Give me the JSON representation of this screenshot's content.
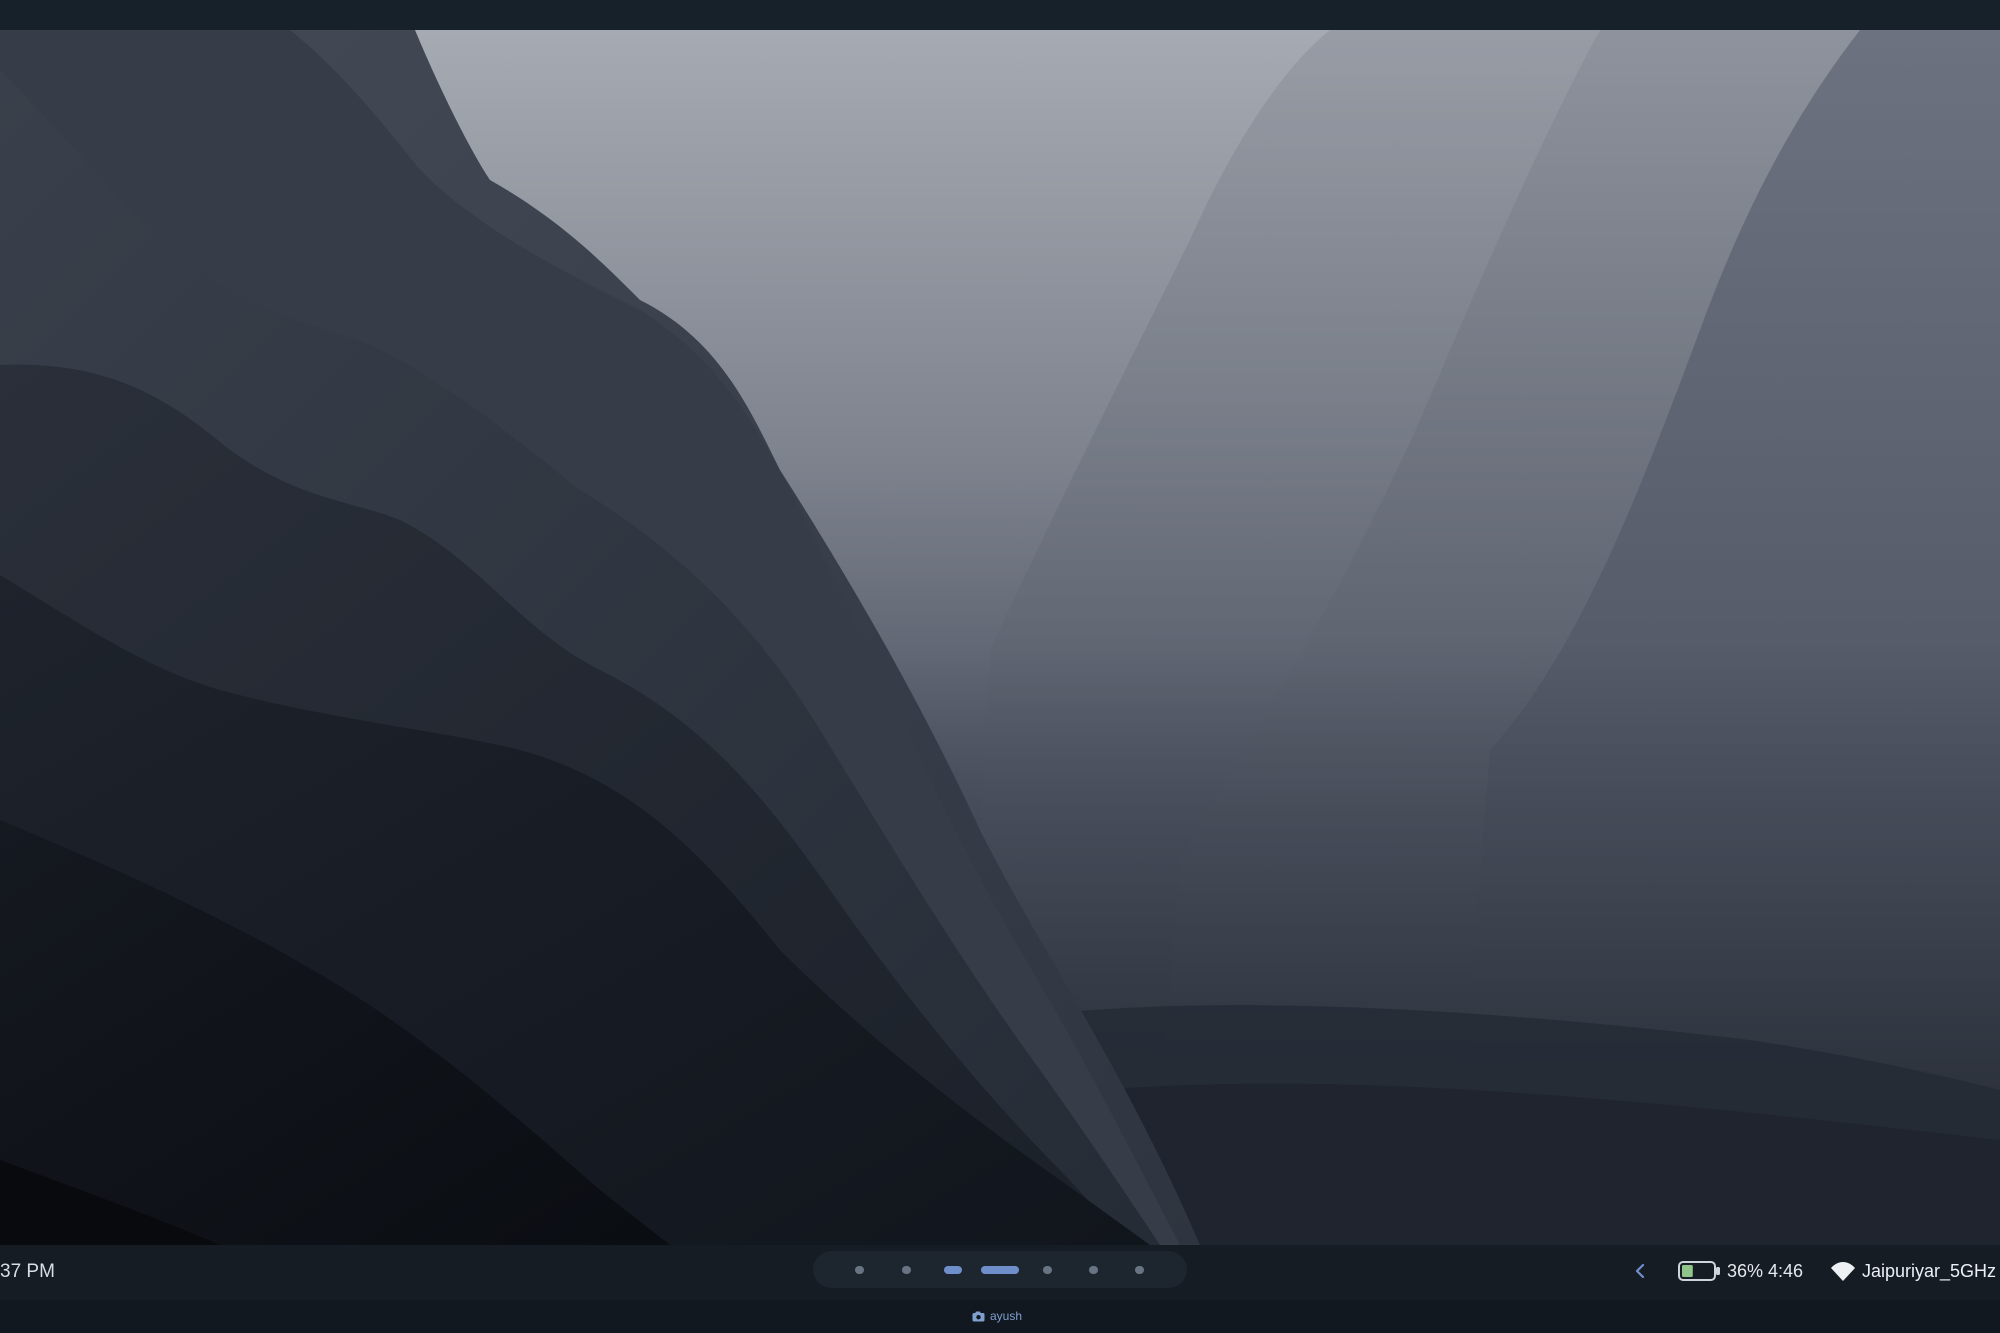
{
  "taskbar": {
    "clock_text": "37 PM",
    "workspaces": [
      {
        "label": "workspace 1",
        "active": false
      },
      {
        "label": "workspace 2",
        "active": false
      },
      {
        "label": "workspace 3",
        "active": true
      },
      {
        "label": "workspace 4",
        "active": true
      },
      {
        "label": "workspace 5",
        "active": false
      },
      {
        "label": "workspace 6",
        "active": false
      },
      {
        "label": "workspace 7",
        "active": false
      }
    ],
    "tray": {
      "chevron_icon": "chevron-left-icon",
      "battery_icon": "battery-icon",
      "battery_level": 0.36,
      "battery_percent": "36%",
      "battery_time": "4:46",
      "wifi_icon": "wifi-icon",
      "wifi_ssid": "Jaipuriyar_5GHz"
    }
  },
  "statusline": {
    "window_icon": "camera-icon",
    "window_title": "ayush"
  },
  "colors": {
    "panel_bg": "#151c23",
    "accent": "#6f8fcb",
    "text": "#e5e8ec"
  }
}
